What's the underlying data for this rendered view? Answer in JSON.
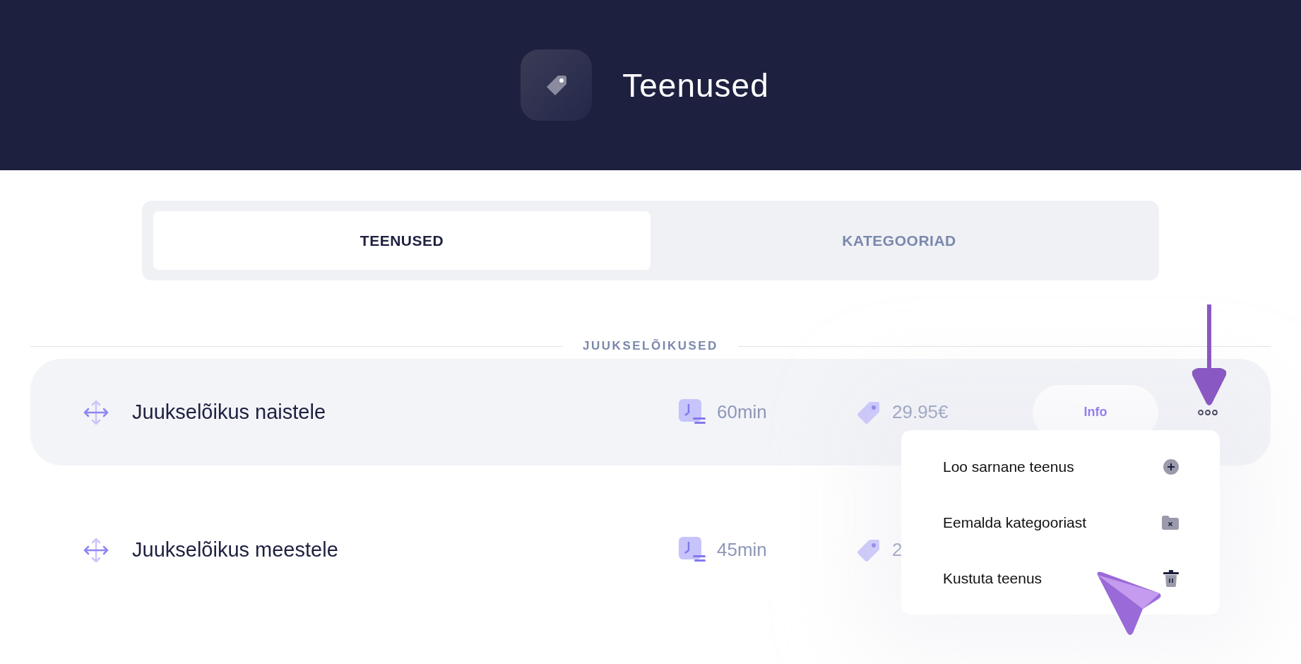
{
  "header": {
    "title": "Teenused"
  },
  "tabs": [
    {
      "label": "TEENUSED",
      "selected": true
    },
    {
      "label": "KATEGOORIAD",
      "selected": false
    }
  ],
  "category": {
    "title": "JUUKSELÕIKUSED"
  },
  "services": [
    {
      "name": "Juukselõikus naistele",
      "duration": "60min",
      "price": "29.95€",
      "highlighted": true,
      "info_button": "Info"
    },
    {
      "name": "Juukselõikus meestele",
      "duration": "45min",
      "price": "2",
      "highlighted": false
    }
  ],
  "context_menu": {
    "open": true,
    "items": [
      {
        "label": "Loo sarnane teenus",
        "kind": "add"
      },
      {
        "label": "Eemalda kategooriast",
        "kind": "remove"
      },
      {
        "label": "Kustuta teenus",
        "kind": "delete"
      }
    ]
  }
}
